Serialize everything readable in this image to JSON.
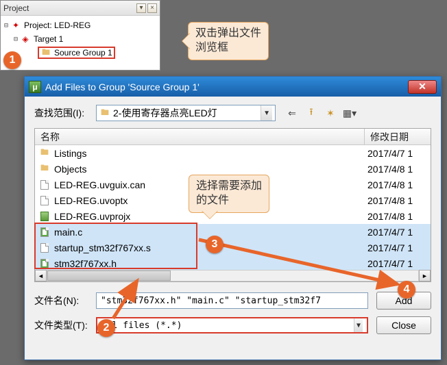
{
  "project_panel": {
    "title": "Project"
  },
  "tree": {
    "root": "Project: LED-REG",
    "target": "Target 1",
    "group": "Source Group 1"
  },
  "callout1": {
    "line1": "双击弹出文件",
    "line2": "浏览框"
  },
  "callout2": {
    "line1": "选择需要添加",
    "line2": "的文件"
  },
  "dialog": {
    "title": "Add Files to Group 'Source Group 1'",
    "lookin_label": "查找范围(I):",
    "lookin_value": "2-使用寄存器点亮LED灯",
    "header_name": "名称",
    "header_date": "修改日期",
    "filename_label": "文件名(N):",
    "filename_value": "\"stm32f767xx.h\" \"main.c\" \"startup_stm32f7",
    "filetype_label": "文件类型(T):",
    "filetype_value": "All files (*.*)",
    "add_label": "Add",
    "close_label": "Close"
  },
  "files": [
    {
      "name": "Listings",
      "date": "2017/4/7 1",
      "type": "folder",
      "selected": false
    },
    {
      "name": "Objects",
      "date": "2017/4/8 1",
      "type": "folder",
      "selected": false
    },
    {
      "name": "LED-REG.uvguix.can",
      "date": "2017/4/8 1",
      "type": "doc",
      "selected": false
    },
    {
      "name": "LED-REG.uvoptx",
      "date": "2017/4/8 1",
      "type": "doc",
      "selected": false
    },
    {
      "name": "LED-REG.uvprojx",
      "date": "2017/4/8 1",
      "type": "proj",
      "selected": false
    },
    {
      "name": "main.c",
      "date": "2017/4/7 1",
      "type": "c",
      "selected": true
    },
    {
      "name": "startup_stm32f767xx.s",
      "date": "2017/4/7 1",
      "type": "doc",
      "selected": true
    },
    {
      "name": "stm32f767xx.h",
      "date": "2017/4/7 1",
      "type": "c",
      "selected": true
    }
  ],
  "badges": {
    "b1": "1",
    "b2": "2",
    "b3": "3",
    "b4": "4"
  }
}
